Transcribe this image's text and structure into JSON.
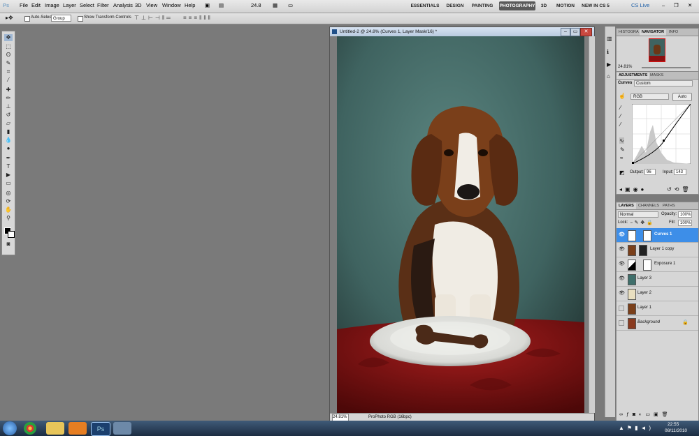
{
  "menubar": {
    "app_logo": "Ps",
    "items": [
      "File",
      "Edit",
      "Image",
      "Layer",
      "Select",
      "Filter",
      "Analysis",
      "3D",
      "View",
      "Window",
      "Help"
    ],
    "zoom_select": "24.8",
    "workspaces": [
      "ESSENTIALS",
      "DESIGN",
      "PAINTING",
      "PHOTOGRAPHY",
      "3D",
      "MOTION",
      "NEW IN CS 5"
    ],
    "active_workspace": "PHOTOGRAPHY",
    "cslive": "CS Live"
  },
  "options": {
    "auto_select_label": "Auto-Select:",
    "auto_select_value": "Group",
    "transform_label": "Show Transform Controls"
  },
  "document": {
    "title": "Untitled-2 @ 24.8% (Curves 1, Layer Mask/16) *",
    "zoom": "24.81%",
    "profile": "ProPhoto RGB (16bpc)"
  },
  "navigator": {
    "tabs": [
      "HISTOGRA",
      "NAVIGATOR",
      "INFO"
    ],
    "zoom": "24.81%"
  },
  "adjustments": {
    "tabs": [
      "ADJUSTMENTS",
      "MASKS"
    ],
    "type": "Curves",
    "preset": "Custom",
    "channel": "RGB",
    "auto_label": "Auto",
    "output_label": "Output:",
    "output_value": "96",
    "input_label": "Input:",
    "input_value": "143"
  },
  "layers": {
    "tabs": [
      "LAYERS",
      "CHANNELS",
      "PATHS"
    ],
    "blend_mode": "Normal",
    "opacity_label": "Opacity:",
    "opacity": "100%",
    "lock_label": "Lock:",
    "fill_label": "Fill:",
    "fill": "100%",
    "items": [
      {
        "name": "Curves 1",
        "selected": true,
        "visible": true
      },
      {
        "name": "Layer 1 copy",
        "selected": false,
        "visible": true
      },
      {
        "name": "Exposure 1",
        "selected": false,
        "visible": true
      },
      {
        "name": "Layer 3",
        "selected": false,
        "visible": true
      },
      {
        "name": "Layer 2",
        "selected": false,
        "visible": true
      },
      {
        "name": "Layer 1",
        "selected": false,
        "visible": false
      },
      {
        "name": "Background",
        "selected": false,
        "visible": false
      }
    ]
  },
  "taskbar": {
    "time": "22:55",
    "date": "08/11/2010"
  },
  "colors": {
    "accent": "#3d8ee8",
    "backdrop": "#3f6360",
    "tablecloth": "#8a1111"
  }
}
